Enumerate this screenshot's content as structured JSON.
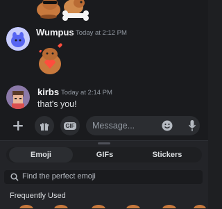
{
  "messages": [
    {
      "author": "Wumpus",
      "timestamp": "Today at 2:12 PM"
    },
    {
      "author": "kirbs",
      "timestamp": "Today at 2:14 PM",
      "text": "that's you!"
    }
  ],
  "composer": {
    "placeholder": "Message..."
  },
  "picker": {
    "tabs": [
      "Emoji",
      "GIFs",
      "Stickers"
    ],
    "active_tab": "Emoji",
    "search_placeholder": "Find the perfect emoji",
    "section_title": "Frequently Used"
  },
  "icons": {
    "plus": "plus-icon",
    "gift": "gift-icon",
    "gif": "gif-icon",
    "emoji": "emoji-icon",
    "mic": "microphone-icon",
    "search": "search-icon"
  },
  "gif_badge": "GIF"
}
